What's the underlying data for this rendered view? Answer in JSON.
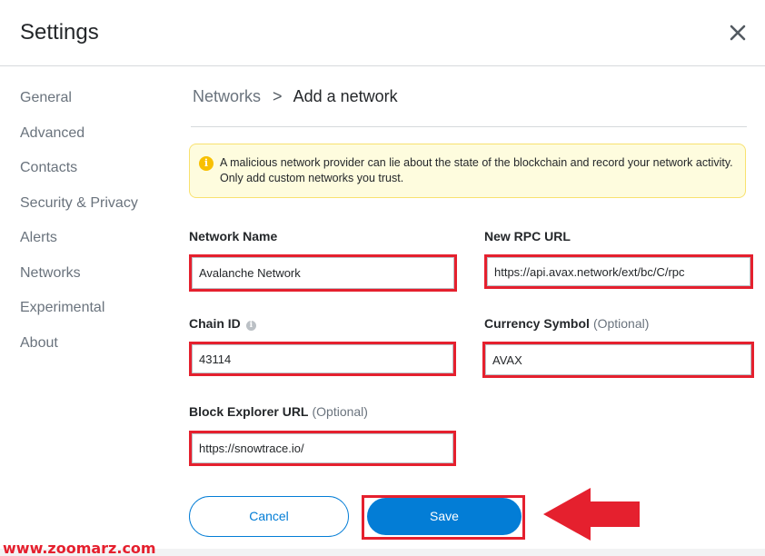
{
  "header": {
    "title": "Settings"
  },
  "sidebar": {
    "items": [
      {
        "label": "General"
      },
      {
        "label": "Advanced"
      },
      {
        "label": "Contacts"
      },
      {
        "label": "Security & Privacy"
      },
      {
        "label": "Alerts"
      },
      {
        "label": "Networks"
      },
      {
        "label": "Experimental"
      },
      {
        "label": "About"
      }
    ]
  },
  "breadcrumb": {
    "parent": "Networks",
    "separator": ">",
    "current": "Add a network"
  },
  "warning": {
    "text": "A malicious network provider can lie about the state of the blockchain and record your network activity. Only add custom networks you trust.",
    "icon": "info-icon"
  },
  "form": {
    "network_name": {
      "label": "Network Name",
      "value": "Avalanche Network"
    },
    "rpc_url": {
      "label": "New RPC URL",
      "value": "https://api.avax.network/ext/bc/C/rpc"
    },
    "chain_id": {
      "label": "Chain ID",
      "value": "43114"
    },
    "currency_symbol": {
      "label": "Currency Symbol",
      "optional": "(Optional)",
      "value": "AVAX"
    },
    "block_explorer": {
      "label": "Block Explorer URL",
      "optional": "(Optional)",
      "value": "https://snowtrace.io/"
    }
  },
  "buttons": {
    "cancel": "Cancel",
    "save": "Save"
  },
  "watermark": "www.zoomarz.com",
  "colors": {
    "accent": "#037dd6",
    "highlight": "#e5202e",
    "warning_bg": "#fefcde",
    "warning_border": "#f8e16f"
  }
}
